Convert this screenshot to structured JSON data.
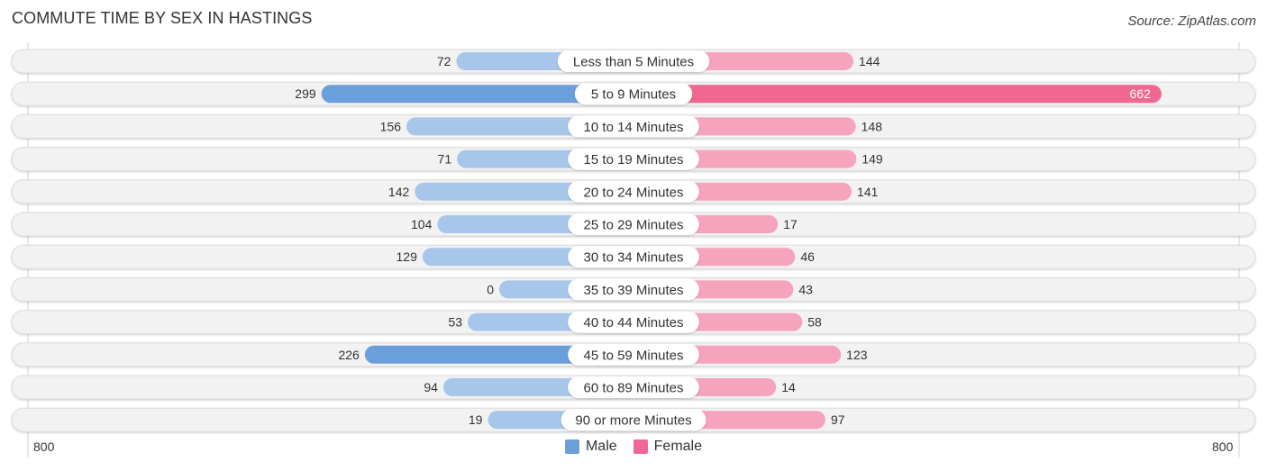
{
  "title": "COMMUTE TIME BY SEX IN HASTINGS",
  "source": "Source: ZipAtlas.com",
  "axis": {
    "left_label": "800",
    "right_label": "800"
  },
  "legend": [
    {
      "label": "Male",
      "color": "#6a9fdc"
    },
    {
      "label": "Female",
      "color": "#f06792"
    }
  ],
  "colors": {
    "male": "#6a9fdc",
    "male_light": "#a7c6ea",
    "female": "#f06792",
    "female_light": "#f6a3bd",
    "track": "#f2f2f2",
    "track_border": "#dcdcdc"
  },
  "chart_data": {
    "type": "bar",
    "orientation": "horizontal-diverging",
    "title": "COMMUTE TIME BY SEX IN HASTINGS",
    "xlabel": "",
    "ylabel": "",
    "xlim": [
      -800,
      800
    ],
    "axis_tick_labels": [
      "800",
      "800"
    ],
    "legend_position": "bottom-center",
    "grid": false,
    "categories": [
      "Less than 5 Minutes",
      "5 to 9 Minutes",
      "10 to 14 Minutes",
      "15 to 19 Minutes",
      "20 to 24 Minutes",
      "25 to 29 Minutes",
      "30 to 34 Minutes",
      "35 to 39 Minutes",
      "40 to 44 Minutes",
      "45 to 59 Minutes",
      "60 to 89 Minutes",
      "90 or more Minutes"
    ],
    "series": [
      {
        "name": "Male",
        "values": [
          72,
          299,
          156,
          71,
          142,
          104,
          129,
          0,
          53,
          226,
          94,
          19
        ]
      },
      {
        "name": "Female",
        "values": [
          144,
          662,
          148,
          149,
          141,
          17,
          46,
          43,
          58,
          123,
          14,
          97
        ]
      }
    ]
  }
}
